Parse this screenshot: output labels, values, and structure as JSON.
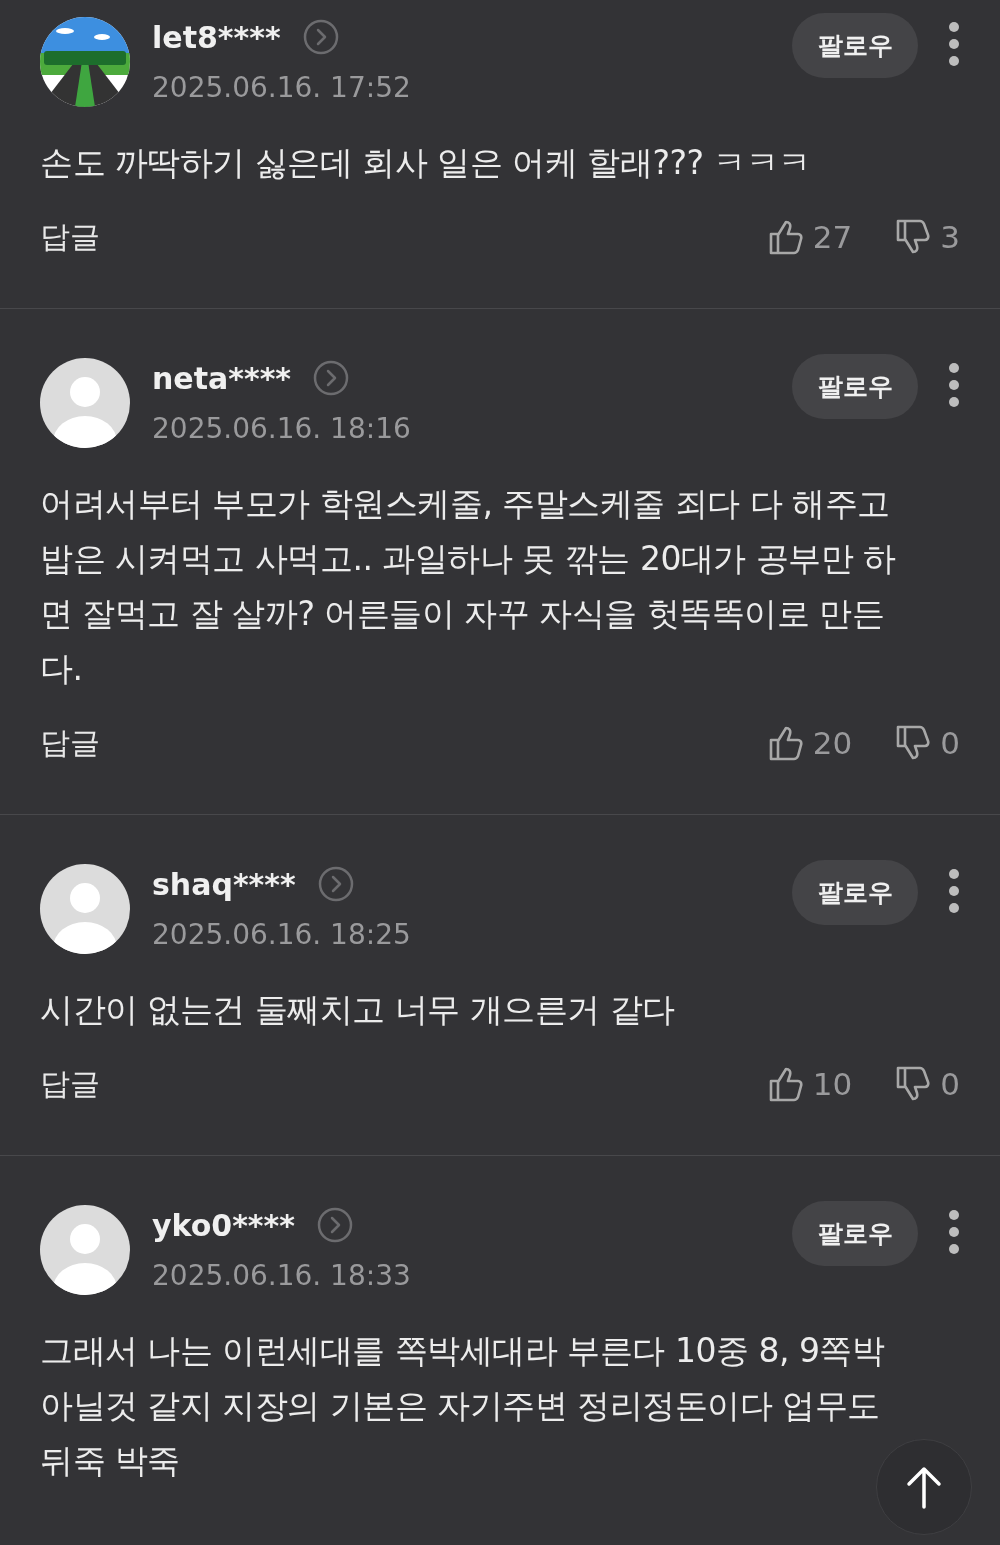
{
  "comments": [
    {
      "username": "let8****",
      "date": "2025.06.16. 17:52",
      "follow": "팔로우",
      "text": "손도 까딱하기 싫은데 회사 일은 어케 할래??? ㅋㅋㅋ",
      "reply": "답글",
      "likes": "27",
      "dislikes": "3"
    },
    {
      "avatar": {
        "kind": "default"
      },
      "username": "neta****",
      "date": "2025.06.16. 18:16",
      "follow": "팔로우",
      "text": "어려서부터 부모가 학원스케줄, 주말스케줄 죄다 다 해주고 밥은 시켜먹고 사먹고.. 과일하나 못 깎는 20대가 공부만 하면 잘먹고 잘 살까? 어른들이 자꾸 자식을 헛똑똑이로 만든다.",
      "reply": "답글",
      "likes": "20",
      "dislikes": "0"
    },
    {
      "avatar": {
        "kind": "default"
      },
      "username": "shaq****",
      "date": "2025.06.16. 18:25",
      "follow": "팔로우",
      "text": "시간이 없는건 둘째치고 너무 개으른거 같다",
      "reply": "답글",
      "likes": "10",
      "dislikes": "0"
    },
    {
      "avatar": {
        "kind": "default"
      },
      "username": "yko0****",
      "date": "2025.06.16. 18:33",
      "follow": "팔로우",
      "text": "그래서 나는 이런세대를 쪽박세대라 부른다 10중 8, 9쪽박 아닐것 같지 지장의 기본은 자기주변 정리정돈이다 업무도 뒤죽 박죽"
    }
  ]
}
